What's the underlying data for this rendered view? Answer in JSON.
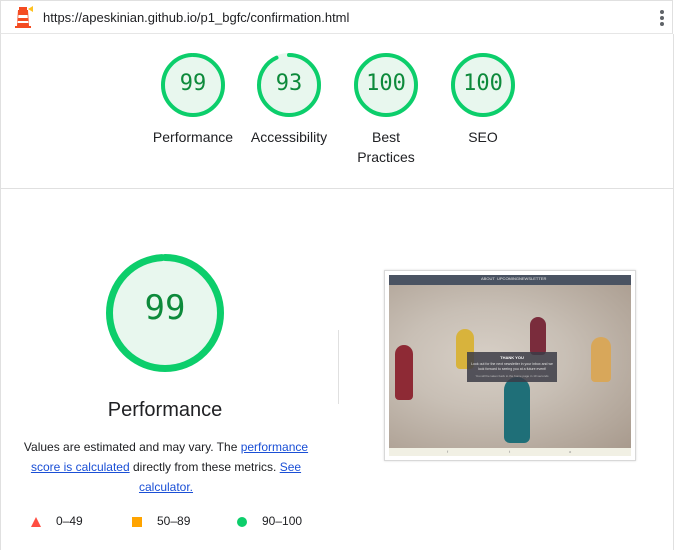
{
  "browser": {
    "url": "https://apeskinian.github.io/p1_bgfc/confirmation.html",
    "logo_icon": "lighthouse-icon",
    "menu_icon": "kebab-menu-icon"
  },
  "colors": {
    "pass_green": "#0cce6b",
    "pass_text": "#0d8a3b",
    "pass_fill": "#e8f7ee",
    "average_orange": "#ffa400",
    "fail_red": "#ff4e42",
    "link_blue": "#1a4fd6"
  },
  "scores": [
    {
      "label": "Performance",
      "score": 99
    },
    {
      "label": "Accessibility",
      "score": 93
    },
    {
      "label": "Best Practices",
      "score": 100
    },
    {
      "label": "SEO",
      "score": 100
    }
  ],
  "performance": {
    "score": 99,
    "title": "Performance",
    "desc_prefix": "Values are estimated and may vary. The ",
    "desc_link1": "performance score is calculated",
    "desc_mid": " directly from these metrics. ",
    "desc_link2": "See calculator."
  },
  "legend": [
    {
      "range": "0–49",
      "shape": "triangle",
      "color": "#ff4e42"
    },
    {
      "range": "50–89",
      "shape": "square",
      "color": "#ffa400"
    },
    {
      "range": "90–100",
      "shape": "circle",
      "color": "#0cce6b"
    }
  ],
  "screenshot": {
    "nav": [
      "ABOUT",
      "UPCOMING",
      "NEWSLETTER"
    ],
    "box_title": "THANK YOU",
    "box_text": "Look out for the next newsletter in your inbox and we look forward to seeing you at a future event!",
    "box_sub": "You will be taken back to the home page in 10 seconds"
  }
}
